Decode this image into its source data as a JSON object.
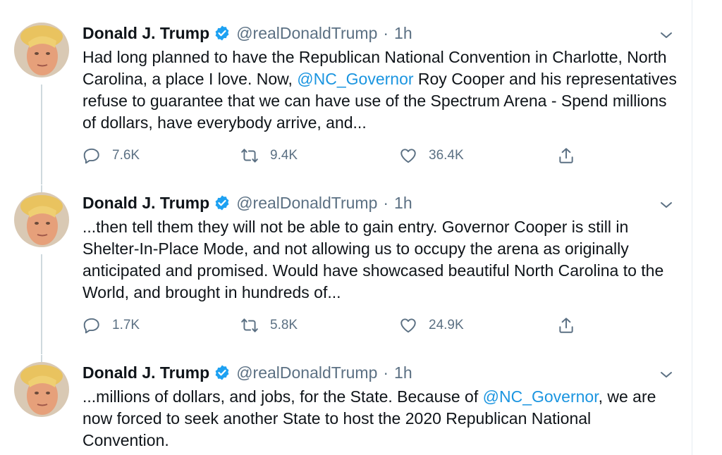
{
  "author": {
    "name": "Donald J. Trump",
    "handle": "@realDonaldTrump",
    "separator": "·"
  },
  "colors": {
    "accent": "#1b95e0",
    "muted": "#5b7083",
    "text": "#0f1419",
    "verified": "#1da1f2"
  },
  "tweets": [
    {
      "time": "1h",
      "text_parts": [
        "Had long planned to have the Republican National Convention in Charlotte, North Carolina, a place I love. Now, ",
        "@NC_Governor",
        " Roy Cooper and his representatives refuse to guarantee that we can have use of the Spectrum Arena - Spend millions of dollars, have everybody arrive, and..."
      ],
      "replies": "7.6K",
      "retweets": "9.4K",
      "likes": "36.4K"
    },
    {
      "time": "1h",
      "text": "...then tell them they will not be able to gain entry. Governor Cooper is still in Shelter-In-Place Mode, and not allowing us to occupy the arena as originally anticipated and promised. Would have showcased beautiful North Carolina to the World, and brought in hundreds of...",
      "replies": "1.7K",
      "retweets": "5.8K",
      "likes": "24.9K"
    },
    {
      "time": "1h",
      "text_parts": [
        "...millions of dollars, and jobs, for the State. Because of ",
        "@NC_Governor",
        ", we are now forced to seek another State to host the 2020 Republican National Convention."
      ]
    }
  ],
  "icons": {
    "reply": "reply-icon",
    "retweet": "retweet-icon",
    "like": "heart-icon",
    "share": "share-icon",
    "verified": "verified-badge-icon",
    "menu": "chevron-down-icon"
  }
}
